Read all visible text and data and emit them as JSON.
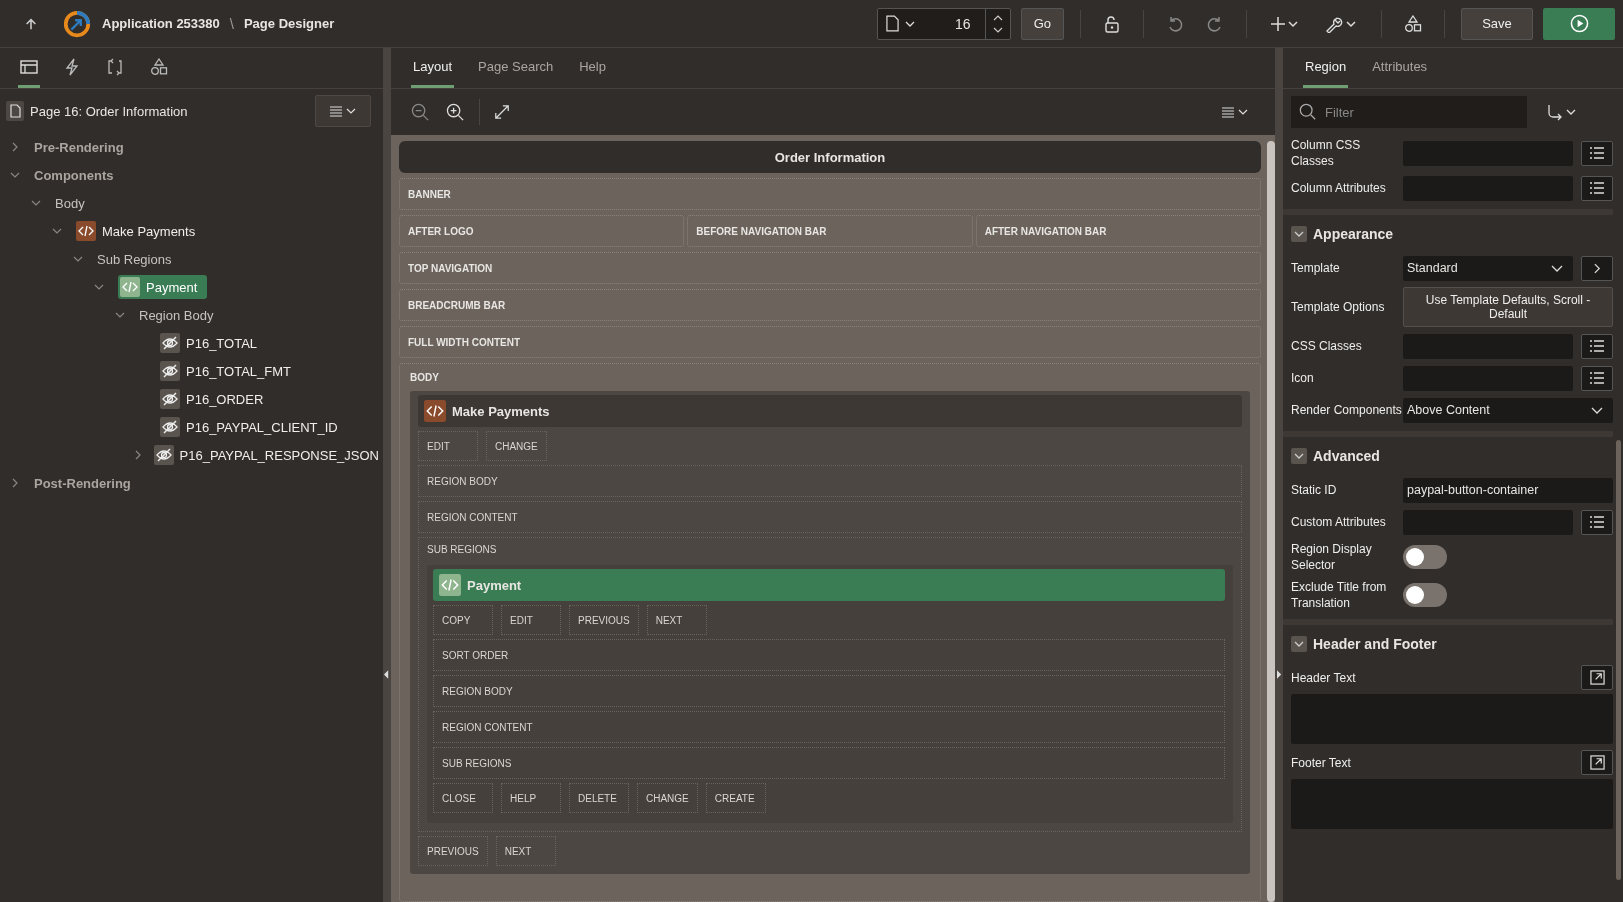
{
  "header": {
    "app_name": "Application 253380",
    "separator": "\\",
    "page_title": "Page Designer",
    "page_number": "16",
    "go_label": "Go",
    "save_label": "Save"
  },
  "left_tabs": [
    {
      "selected": true
    },
    {
      "selected": false
    },
    {
      "selected": false
    },
    {
      "selected": false
    }
  ],
  "page_node": "Page 16: Order Information",
  "tree": [
    {
      "label": "Pre-Rendering",
      "kind": "group",
      "expanded": false,
      "selected": false
    },
    {
      "label": "Components",
      "kind": "group",
      "expanded": true,
      "selected": false,
      "children": [
        {
          "label": "Body",
          "kind": "group",
          "expanded": true,
          "selected": false,
          "children": [
            {
              "label": "Make Payments",
              "kind": "region",
              "expanded": true,
              "selected": false,
              "children": [
                {
                  "label": "Sub Regions",
                  "kind": "group",
                  "expanded": true,
                  "selected": false,
                  "children": [
                    {
                      "label": "Payment",
                      "kind": "region",
                      "expanded": true,
                      "selected": true,
                      "children": [
                        {
                          "label": "Region Body",
                          "kind": "group",
                          "expanded": true,
                          "selected": false,
                          "children": [
                            {
                              "label": "P16_TOTAL",
                              "kind": "item",
                              "selected": false
                            },
                            {
                              "label": "P16_TOTAL_FMT",
                              "kind": "item",
                              "selected": false
                            },
                            {
                              "label": "P16_ORDER",
                              "kind": "item",
                              "selected": false
                            },
                            {
                              "label": "P16_PAYPAL_CLIENT_ID",
                              "kind": "item",
                              "selected": false
                            },
                            {
                              "label": "P16_PAYPAL_RESPONSE_JSON",
                              "kind": "item",
                              "expanded": false,
                              "selected": false
                            }
                          ]
                        }
                      ]
                    }
                  ]
                }
              ]
            }
          ]
        }
      ]
    },
    {
      "label": "Post-Rendering",
      "kind": "group",
      "expanded": false,
      "selected": false
    }
  ],
  "center_tabs": [
    {
      "label": "Layout",
      "selected": true
    },
    {
      "label": "Page Search",
      "selected": false
    },
    {
      "label": "Help",
      "selected": false
    }
  ],
  "layout": {
    "page_title": "Order Information",
    "position_rows": [
      [
        "BANNER"
      ],
      [
        "AFTER LOGO",
        "BEFORE NAVIGATION BAR",
        "AFTER NAVIGATION BAR"
      ],
      [
        "TOP NAVIGATION"
      ],
      [
        "BREADCRUMB BAR"
      ],
      [
        "FULL WIDTH CONTENT"
      ]
    ],
    "body_label": "BODY",
    "region": {
      "title": "Make Payments",
      "selected": false,
      "top_buttons": [
        "EDIT",
        "CHANGE"
      ],
      "slots": [
        "REGION BODY",
        "REGION CONTENT"
      ],
      "sub_label": "SUB REGIONS",
      "sub_region": {
        "title": "Payment",
        "selected": true,
        "top_buttons": [
          "COPY",
          "EDIT",
          "PREVIOUS",
          "NEXT"
        ],
        "slots": [
          "SORT ORDER",
          "REGION BODY",
          "REGION CONTENT",
          "SUB REGIONS"
        ],
        "bottom_buttons": [
          "CLOSE",
          "HELP",
          "DELETE",
          "CHANGE",
          "CREATE"
        ]
      },
      "bottom_buttons": [
        "PREVIOUS",
        "NEXT"
      ]
    }
  },
  "right_tabs": [
    {
      "label": "Region",
      "selected": true
    },
    {
      "label": "Attributes",
      "selected": false
    }
  ],
  "filter": {
    "placeholder": "Filter"
  },
  "top_properties": [
    {
      "label": "Column CSS Classes",
      "kind": "picker"
    },
    {
      "label": "Column Attributes",
      "kind": "picker"
    }
  ],
  "sections": [
    {
      "title": "Appearance",
      "expanded": true,
      "properties": [
        {
          "label": "Template",
          "kind": "select_link",
          "value": "Standard"
        },
        {
          "label": "Template Options",
          "kind": "button",
          "value": "Use Template Defaults, Scroll - Default"
        },
        {
          "label": "CSS Classes",
          "kind": "picker"
        },
        {
          "label": "Icon",
          "kind": "picker"
        },
        {
          "label": "Render Components",
          "kind": "select",
          "value": "Above Content"
        }
      ]
    },
    {
      "title": "Advanced",
      "expanded": true,
      "properties": [
        {
          "label": "Static ID",
          "kind": "text",
          "value": "paypal-button-container"
        },
        {
          "label": "Custom Attributes",
          "kind": "picker"
        },
        {
          "label": "Region Display Selector",
          "kind": "switch",
          "on": false
        },
        {
          "label": "Exclude Title from Translation",
          "kind": "switch",
          "on": false
        }
      ]
    },
    {
      "title": "Header and Footer",
      "expanded": true,
      "properties": [
        {
          "label": "Header Text",
          "kind": "textarea"
        },
        {
          "label": "Footer Text",
          "kind": "textarea"
        }
      ]
    }
  ]
}
